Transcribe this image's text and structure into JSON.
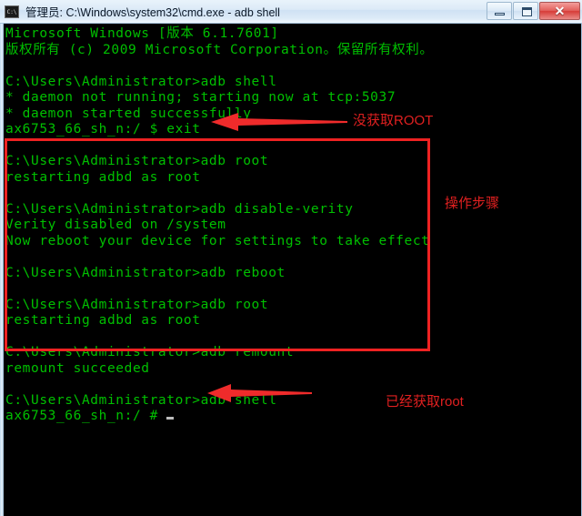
{
  "window": {
    "title": "管理员: C:\\Windows\\system32\\cmd.exe - adb  shell",
    "icon": "cmd-icon",
    "icon_label": "C:\\",
    "buttons": {
      "minimize": "–",
      "maximize": "□",
      "close": "✕"
    }
  },
  "console": {
    "foreground_color": "#00c000",
    "background_color": "#000000",
    "lines": [
      "Microsoft Windows [版本 6.1.7601]",
      "版权所有 (c) 2009 Microsoft Corporation。保留所有权利。",
      "",
      "C:\\Users\\Administrator>adb shell",
      "* daemon not running; starting now at tcp:5037",
      "* daemon started successfully",
      "ax6753_66_sh_n:/ $ exit",
      "",
      "C:\\Users\\Administrator>adb root",
      "restarting adbd as root",
      "",
      "C:\\Users\\Administrator>adb disable-verity",
      "Verity disabled on /system",
      "Now reboot your device for settings to take effect",
      "",
      "C:\\Users\\Administrator>adb reboot",
      "",
      "C:\\Users\\Administrator>adb root",
      "restarting adbd as root",
      "",
      "C:\\Users\\Administrator>adb remount",
      "remount succeeded",
      "",
      "C:\\Users\\Administrator>adb shell",
      "ax6753_66_sh_n:/ #"
    ]
  },
  "annotations": {
    "color": "#e02020",
    "box_label": "operation-steps-box",
    "labels": {
      "no_root": "没获取ROOT",
      "steps": "操作步骤",
      "has_root": "已经获取root"
    },
    "arrows": [
      {
        "name": "arrow-no-root",
        "direction": "left"
      },
      {
        "name": "arrow-has-root",
        "direction": "left"
      }
    ]
  }
}
